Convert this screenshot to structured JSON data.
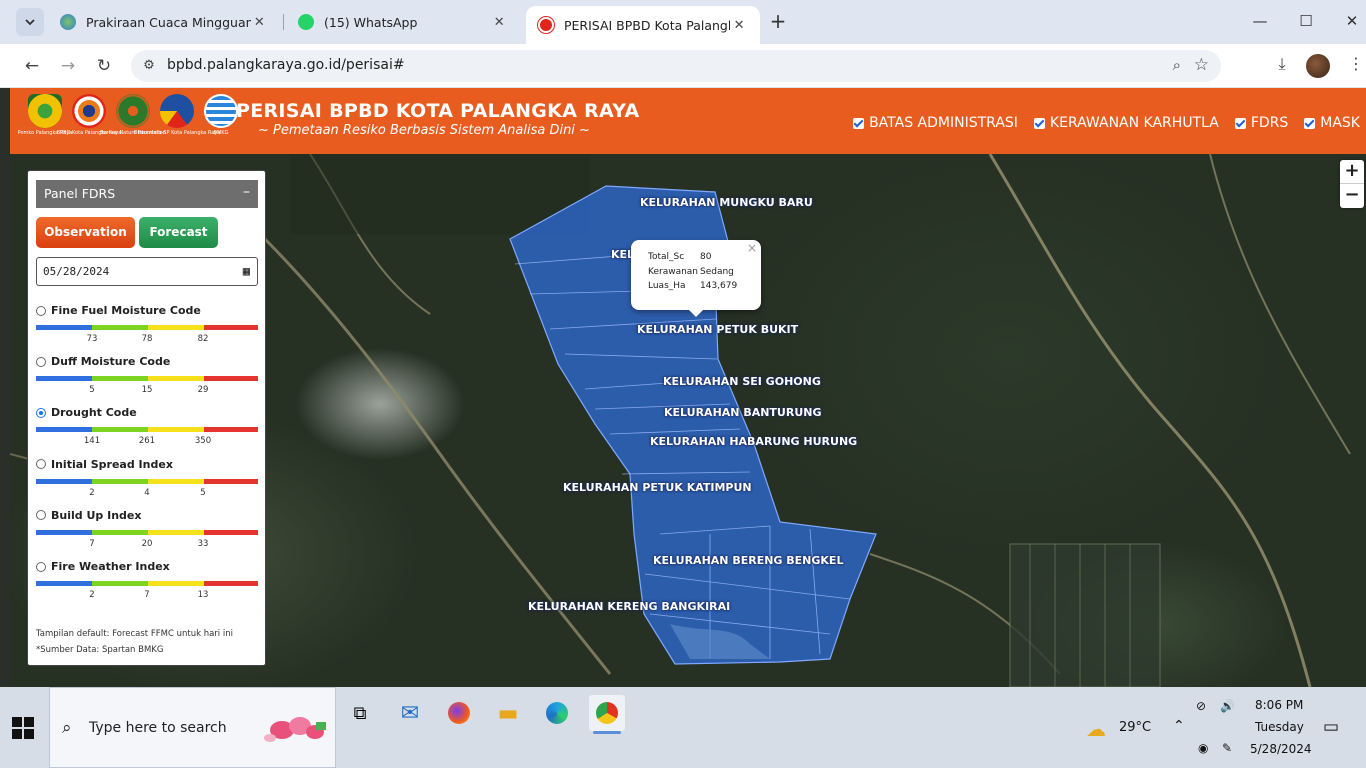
{
  "browser": {
    "tabs": [
      {
        "title": "Prakiraan Cuaca Mingguan | BM",
        "active": false
      },
      {
        "title": "(15) WhatsApp",
        "active": false
      },
      {
        "title": "PERISAI BPBD Kota Palangka Ra",
        "active": true
      }
    ],
    "new_tab_label": "+",
    "url": "bpbd.palangkaraya.go.id/perisai#",
    "window_controls": {
      "minimize": "—",
      "maximize": "☐",
      "close": "✕"
    }
  },
  "site": {
    "title": "PERISAI BPBD KOTA PALANGKA RAYA",
    "subtitle": "~ Pemetaan Resiko Berbasis Sistem Analisa Dini ~",
    "logos": [
      {
        "caption": "Pemko Palangka Raya",
        "color": "#f2c200"
      },
      {
        "caption": "BPBD Kota Palangka Raya",
        "color": "#e0251b"
      },
      {
        "caption": "Borneo Nature Foundation",
        "color": "#2b7a2b"
      },
      {
        "caption": "Diskominfo-SP Kota Palangka Raya",
        "color": "#1f4fa0"
      },
      {
        "caption": "BMKG",
        "color": "#2a86d8"
      }
    ],
    "layers": [
      {
        "label": "BATAS ADMINISTRASI",
        "checked": true
      },
      {
        "label": "KERAWANAN KARHUTLA",
        "checked": true
      },
      {
        "label": "FDRS",
        "checked": true
      },
      {
        "label": "MASK",
        "checked": true
      }
    ]
  },
  "map": {
    "zoom_in": "+",
    "zoom_out": "−",
    "labels": [
      {
        "text": "KELURAHAN MUNGKU BARU"
      },
      {
        "text": "KEL"
      },
      {
        "text": "KELURAHAN PETUK BUKIT"
      },
      {
        "text": "KELURAHAN SEI GOHONG"
      },
      {
        "text": "KELURAHAN BANTURUNG"
      },
      {
        "text": "KELURAHAN HABARUNG HURUNG"
      },
      {
        "text": "KELURAHAN PETUK KATIMPUN"
      },
      {
        "text": "KELURAHAN BERENG BENGKEL"
      },
      {
        "text": "KELURAHAN KERENG BANGKIRAI"
      }
    ],
    "popup": {
      "close": "×",
      "rows": [
        {
          "key": "Total_Sc",
          "value": "80"
        },
        {
          "key": "Kerawanan",
          "value": "Sedang"
        },
        {
          "key": "Luas_Ha",
          "value": "143,679"
        }
      ]
    },
    "polygon_color": "#2f6fe0"
  },
  "panel": {
    "title": "Panel FDRS",
    "minimize": "–",
    "observation_label": "Observation",
    "forecast_label": "Forecast",
    "date_value": "05/28/2024",
    "scale_colors": [
      "#2f6fe0",
      "#7ed321",
      "#f5e21c",
      "#e3342f"
    ],
    "indices": [
      {
        "name": "Fine Fuel Moisture Code",
        "selected": false,
        "ticks": [
          "73",
          "78",
          "82"
        ]
      },
      {
        "name": "Duff Moisture Code",
        "selected": false,
        "ticks": [
          "5",
          "15",
          "29"
        ]
      },
      {
        "name": "Drought Code",
        "selected": true,
        "ticks": [
          "141",
          "261",
          "350"
        ]
      },
      {
        "name": "Initial Spread Index",
        "selected": false,
        "ticks": [
          "2",
          "4",
          "5"
        ]
      },
      {
        "name": "Build Up Index",
        "selected": false,
        "ticks": [
          "7",
          "20",
          "33"
        ]
      },
      {
        "name": "Fire Weather Index",
        "selected": false,
        "ticks": [
          "2",
          "7",
          "13"
        ]
      }
    ],
    "note_default": "Tampilan default: Forecast FFMC untuk hari ini",
    "note_source": "*Sumber Data: Spartan BMKG"
  },
  "taskbar": {
    "search_placeholder": "Type here to search",
    "weather_temp": "29°C",
    "time": "8:06 PM",
    "day": "Tuesday",
    "date": "5/28/2024"
  }
}
